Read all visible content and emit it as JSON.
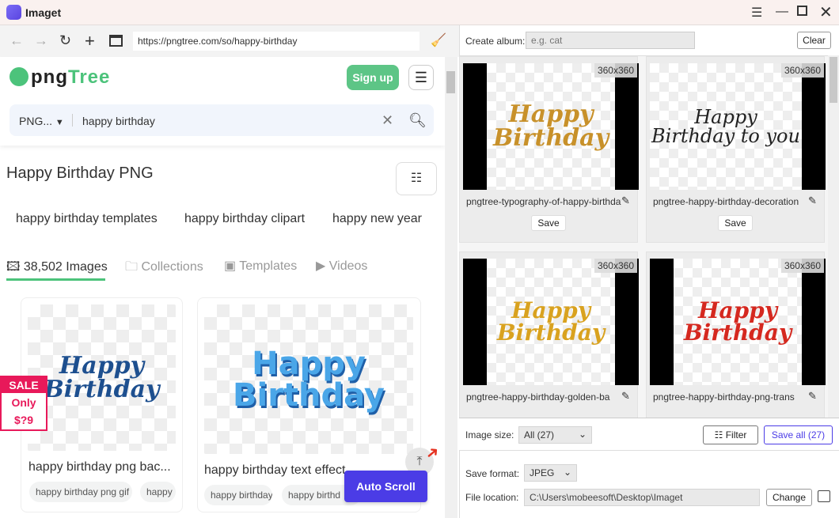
{
  "app": {
    "title": "Imaget",
    "window_controls": [
      "menu-icon",
      "minimize-icon",
      "maximize-icon",
      "close-icon"
    ]
  },
  "browser": {
    "url": "https://pngtree.com/so/happy-birthday"
  },
  "site": {
    "logo": "pngtree",
    "signup": "Sign up",
    "search": {
      "type": "PNG...",
      "query": "happy birthday"
    },
    "page_title": "Happy Birthday PNG",
    "suggestions": [
      "happy birthday templates",
      "happy birthday clipart",
      "happy new year"
    ],
    "tabs": [
      {
        "label": "38,502 Images",
        "active": true
      },
      {
        "label": "Collections"
      },
      {
        "label": "Templates"
      },
      {
        "label": "Videos"
      }
    ],
    "results": [
      {
        "art": "Happy Birthday",
        "caption": "happy birthday png bac...",
        "chips": [
          "happy birthday png gif",
          "happy"
        ]
      },
      {
        "art": "Happy Birthday",
        "caption": "happy birthday text effect",
        "chips": [
          "happy birthday",
          "happy birthd"
        ]
      }
    ],
    "sale": {
      "badge": "SALE",
      "line1": "Only",
      "line2": "$?9"
    },
    "auto_scroll": "Auto Scroll"
  },
  "panel": {
    "create_album_label": "Create album:",
    "album_placeholder": "e.g. cat",
    "clear": "Clear",
    "images": [
      {
        "art": "Happy Birthday",
        "size": "360x360",
        "name": "pngtree-typography-of-happy-birthday",
        "save": "Save",
        "color": "#c8912a"
      },
      {
        "art": "Happy Birthday to you",
        "size": "360x360",
        "name": "pngtree-happy-birthday-decoration",
        "save": "Save",
        "color": "#222222"
      },
      {
        "art": "Happy Birthday",
        "size": "360x360",
        "name": "pngtree-happy-birthday-golden-ba",
        "save": "Save",
        "color": "#d9a21f"
      },
      {
        "art": "Happy Birthday",
        "size": "360x360",
        "name": "pngtree-happy-birthday-png-trans",
        "save": "Save",
        "color": "#d5281f"
      }
    ],
    "image_size_label": "Image size:",
    "image_size_value": "All (27)",
    "filter": "Filter",
    "save_all": "Save all (27)",
    "save_format_label": "Save format:",
    "save_format_value": "JPEG",
    "file_location_label": "File location:",
    "file_location_value": "C:\\Users\\mobeesoft\\Desktop\\Imaget",
    "change": "Change"
  }
}
